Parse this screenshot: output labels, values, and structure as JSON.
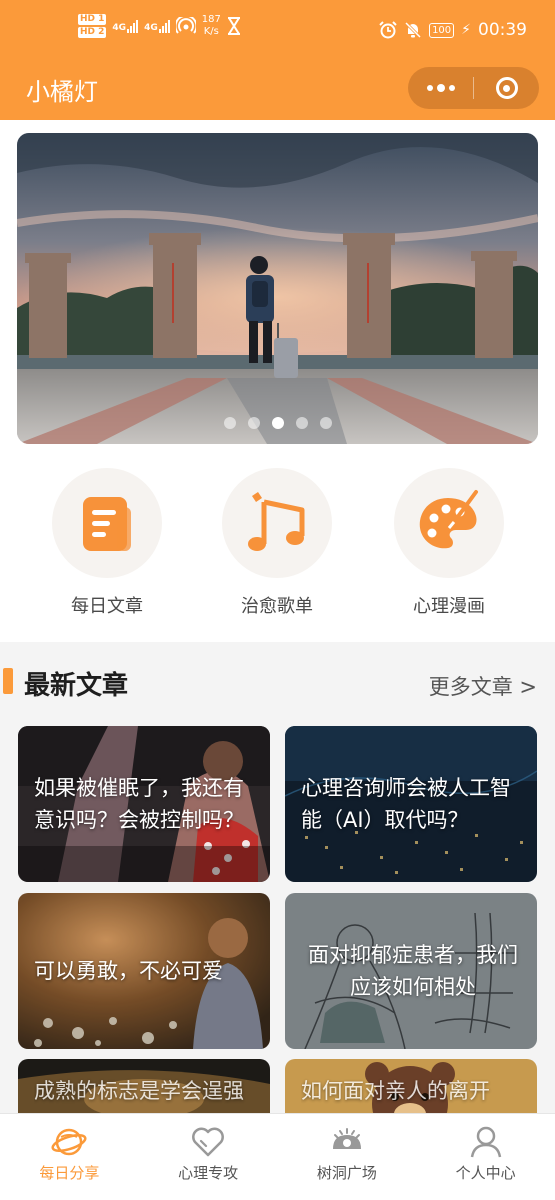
{
  "status_bar": {
    "hd1": "HD 1",
    "hd2": "HD 2",
    "net1": "4G",
    "net2": "4G",
    "speed_value": "187",
    "speed_unit": "K/s",
    "battery": "100",
    "time": "00:39"
  },
  "nav": {
    "title": "小橘灯"
  },
  "categories": [
    {
      "label": "每日文章",
      "icon": "article-icon"
    },
    {
      "label": "治愈歌单",
      "icon": "music-note-icon"
    },
    {
      "label": "心理漫画",
      "icon": "palette-icon"
    }
  ],
  "banner": {
    "page_count": 5,
    "active_index": 2
  },
  "section": {
    "title": "最新文章",
    "more_label": "更多文章 >"
  },
  "articles": [
    {
      "title": "如果被催眠了，我还有意识吗？会被控制吗？"
    },
    {
      "title": "心理咨询师会被人工智能（AI）取代吗？"
    },
    {
      "title": "可以勇敢，不必可爱"
    },
    {
      "title": "面对抑郁症患者，我们应该如何相处"
    },
    {
      "title": "成熟的标志是学会逞强"
    },
    {
      "title": "如何面对亲人的离开"
    }
  ],
  "tabbar": {
    "active_index": 0,
    "tabs": [
      {
        "label": "每日分享",
        "icon": "planet-icon"
      },
      {
        "label": "心理专攻",
        "icon": "heart-icon"
      },
      {
        "label": "树洞广场",
        "icon": "tree-hole-icon"
      },
      {
        "label": "个人中心",
        "icon": "person-icon"
      }
    ]
  },
  "colors": {
    "accent": "#fb9a3a",
    "icon_orange": "#f7923a",
    "tab_inactive": "#555555"
  }
}
